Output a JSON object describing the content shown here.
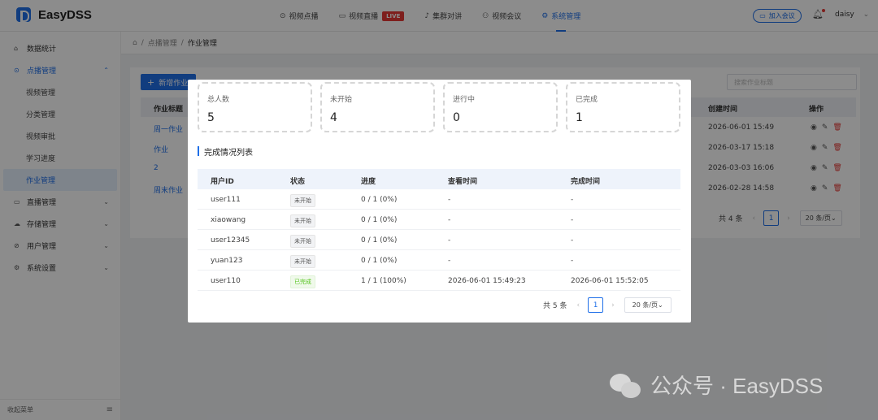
{
  "app": {
    "name": "EasyDSS"
  },
  "nav": {
    "items": [
      {
        "icon": "play-icon",
        "label": "视频点播"
      },
      {
        "icon": "video-icon",
        "label": "视频直播",
        "badge": "LIVE"
      },
      {
        "icon": "mic-icon",
        "label": "集群对讲"
      },
      {
        "icon": "meeting-icon",
        "label": "视频会议"
      },
      {
        "icon": "gear-icon",
        "label": "系统管理"
      }
    ],
    "active": 4
  },
  "header": {
    "join_label": "加入会议",
    "username": "daisy"
  },
  "sidebar": {
    "items": [
      {
        "label": "数据统计"
      },
      {
        "label": "点播管理"
      },
      {
        "label": "视频管理"
      },
      {
        "label": "分类管理"
      },
      {
        "label": "视频审批"
      },
      {
        "label": "学习进度"
      },
      {
        "label": "作业管理"
      },
      {
        "label": "直播管理"
      },
      {
        "label": "存储管理"
      },
      {
        "label": "用户管理"
      },
      {
        "label": "系统设置"
      }
    ],
    "collapse_label": "收起菜单"
  },
  "breadcrumb": {
    "parent": "点播管理",
    "current": "作业管理"
  },
  "page": {
    "add_label": "新增作业",
    "search_placeholder": "搜索作业标题",
    "columns": {
      "title": "作业标题",
      "created": "创建时间",
      "ops": "操作"
    },
    "rows": [
      {
        "title": "周一作业",
        "created": "2026-06-01 15:49"
      },
      {
        "title": "作业",
        "created": "2026-03-17 15:18"
      },
      {
        "title": "2",
        "created": "2026-03-03 16:06"
      },
      {
        "title": "周末作业",
        "created": "2026-02-28 14:58"
      }
    ],
    "pagination": {
      "total": "共 4 条",
      "page": "1",
      "size": "20 条/页"
    }
  },
  "modal": {
    "stats": [
      {
        "label": "总人数",
        "value": "5"
      },
      {
        "label": "未开始",
        "value": "4"
      },
      {
        "label": "进行中",
        "value": "0"
      },
      {
        "label": "已完成",
        "value": "1"
      }
    ],
    "section_title": "完成情况列表",
    "columns": {
      "user": "用户ID",
      "status": "状态",
      "progress": "进度",
      "view_time": "查看时间",
      "done_time": "完成时间"
    },
    "rows": [
      {
        "user": "user111",
        "status": "未开始",
        "progress": "0 / 1 (0%)",
        "view_time": "-",
        "done_time": "-"
      },
      {
        "user": "xiaowang",
        "status": "未开始",
        "progress": "0 / 1 (0%)",
        "view_time": "-",
        "done_time": "-"
      },
      {
        "user": "user12345",
        "status": "未开始",
        "progress": "0 / 1 (0%)",
        "view_time": "-",
        "done_time": "-"
      },
      {
        "user": "yuan123",
        "status": "未开始",
        "progress": "0 / 1 (0%)",
        "view_time": "-",
        "done_time": "-"
      },
      {
        "user": "user110",
        "status": "已完成",
        "progress": "1 / 1 (100%)",
        "view_time": "2026-06-01 15:49:23",
        "done_time": "2026-06-01 15:52:05"
      }
    ],
    "pagination": {
      "total": "共 5 条",
      "page": "1",
      "size": "20 条/页"
    }
  },
  "watermark": {
    "text": "公众号 · EasyDSS"
  },
  "colors": {
    "accent": "#1f6fe8",
    "live": "#e53935",
    "done": "#52c41a"
  }
}
